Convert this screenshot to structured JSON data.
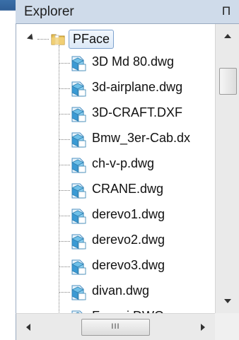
{
  "panel": {
    "title": "Explorer",
    "pin_glyph": "Π"
  },
  "tree": {
    "root": {
      "label": "PFace",
      "icon": "folder-icon",
      "expanded": true
    },
    "files": [
      {
        "label": "3D Md 80.dwg"
      },
      {
        "label": "3d-airplane.dwg"
      },
      {
        "label": "3D-CRAFT.DXF"
      },
      {
        "label": "Bmw_3er-Cab.dx"
      },
      {
        "label": "ch-v-p.dwg"
      },
      {
        "label": "CRANE.dwg"
      },
      {
        "label": "derevo1.dwg"
      },
      {
        "label": "derevo2.dwg"
      },
      {
        "label": "derevo3.dwg"
      },
      {
        "label": "divan.dwg"
      },
      {
        "label": "Ferrari.DWG"
      }
    ]
  },
  "scrollbars": {
    "horizontal_thumb_grip": "III"
  },
  "colors": {
    "titlebar": "#cfdbea",
    "selection_border": "#7da2ce",
    "accent_blue": "#3a6fa8"
  }
}
